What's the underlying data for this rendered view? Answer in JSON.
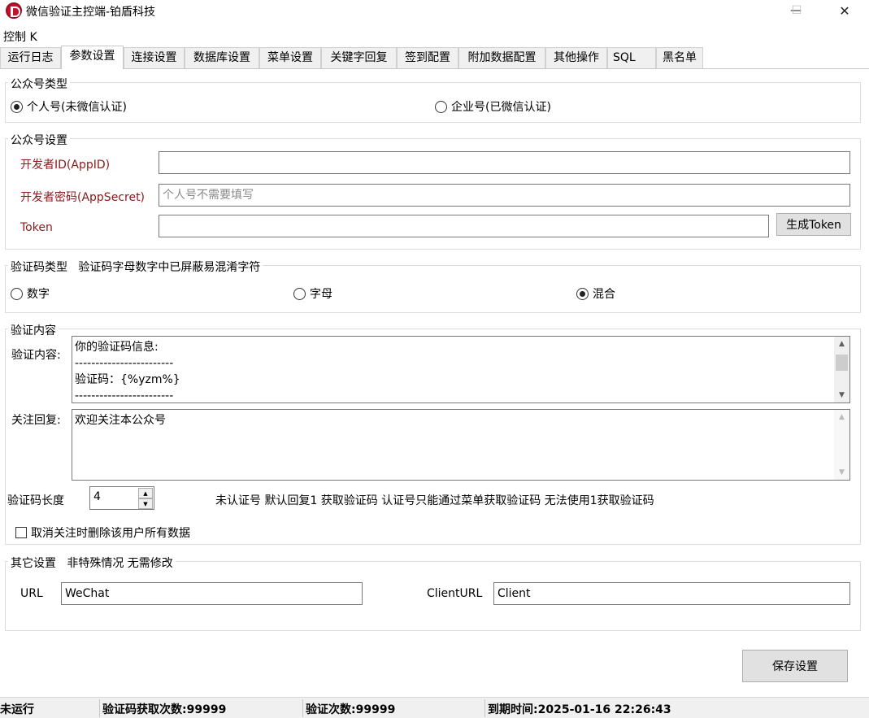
{
  "window": {
    "title": "微信验证主控端-铂盾科技",
    "minimize_glyph": "—",
    "maximize_glyph": "☐",
    "close_glyph": "✕"
  },
  "menu": {
    "control": "控制 K"
  },
  "tabs": [
    {
      "label": "运行日志"
    },
    {
      "label": "参数设置"
    },
    {
      "label": "连接设置"
    },
    {
      "label": "数据库设置"
    },
    {
      "label": "菜单设置"
    },
    {
      "label": "关键字回复"
    },
    {
      "label": "签到配置"
    },
    {
      "label": "附加数据配置"
    },
    {
      "label": "其他操作"
    },
    {
      "label": "SQL"
    },
    {
      "label": "黑名单"
    }
  ],
  "account_type": {
    "legend": "公众号类型",
    "personal": "个人号(未微信认证)",
    "enterprise": "企业号(已微信认证)",
    "selected": "personal"
  },
  "account_settings": {
    "legend": "公众号设置",
    "appid_label": "开发者ID(AppID)",
    "appid_value": "",
    "secret_label": "开发者密码(AppSecret)",
    "secret_placeholder": "个人号不需要填写",
    "token_label": "Token",
    "token_value": "",
    "generate_token": "生成Token"
  },
  "code_type": {
    "legend": "验证码类型",
    "note": "验证码字母数字中已屏蔽易混淆字符",
    "digits": "数字",
    "letters": "字母",
    "mixed": "混合",
    "selected": "mixed"
  },
  "verify_content": {
    "legend": "验证内容",
    "content_label": "验证内容:",
    "content_lines": [
      "你的验证码信息:",
      "------------------------",
      "验证码：{%yzm%}",
      "------------------------"
    ],
    "follow_label": "关注回复:",
    "follow_text": "欢迎关注本公众号",
    "code_length_label": "验证码长度",
    "code_length_value": "4",
    "hint": "未认证号 默认回复1 获取验证码 认证号只能通过菜单获取验证码 无法使用1获取验证码",
    "delete_on_unfollow": "取消关注时删除该用户所有数据",
    "delete_on_unfollow_checked": false
  },
  "other_settings": {
    "legend": "其它设置",
    "note": "非特殊情况 无需修改",
    "url_label": "URL",
    "url_value": "WeChat",
    "client_url_label": "ClientURL",
    "client_url_value": "Client"
  },
  "save_button": "保存设置",
  "status": {
    "state": "未运行",
    "fetch_count": "验证码获取次数:99999",
    "verify_count": "验证次数:99999",
    "expire": "到期时间:2025-01-16 22:26:43"
  }
}
